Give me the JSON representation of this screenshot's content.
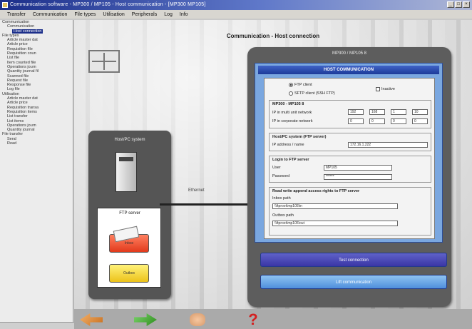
{
  "window": {
    "title": "Communication software - MP300 / MP105 - Host communication - [MP300 MP105]"
  },
  "menu": [
    "Transfer",
    "Communication",
    "File types",
    "Utilisation",
    "Peripherals",
    "Log",
    "Info"
  ],
  "tree": {
    "nodes": [
      {
        "label": "Communication",
        "depth": 0
      },
      {
        "label": "Communication",
        "depth": 1
      },
      {
        "label": "Host connection",
        "depth": 2,
        "selected": true
      },
      {
        "label": "File types",
        "depth": 0
      },
      {
        "label": "Article master dat",
        "depth": 1
      },
      {
        "label": "Article price",
        "depth": 1
      },
      {
        "label": "Requisition file",
        "depth": 1
      },
      {
        "label": "Requisition coun",
        "depth": 1
      },
      {
        "label": "List file",
        "depth": 1
      },
      {
        "label": "Item counted file",
        "depth": 1
      },
      {
        "label": "Operations journ",
        "depth": 1
      },
      {
        "label": "Quantity journal fil",
        "depth": 1
      },
      {
        "label": "Scanned file",
        "depth": 1
      },
      {
        "label": "Request file",
        "depth": 1
      },
      {
        "label": "Response file",
        "depth": 1
      },
      {
        "label": "Log file",
        "depth": 1
      },
      {
        "label": "Utilisation",
        "depth": 0
      },
      {
        "label": "Article master dat",
        "depth": 1
      },
      {
        "label": "Article price",
        "depth": 1
      },
      {
        "label": "Requisition transa",
        "depth": 1
      },
      {
        "label": "Requisition items",
        "depth": 1
      },
      {
        "label": "List transfer",
        "depth": 1
      },
      {
        "label": "List items",
        "depth": 1
      },
      {
        "label": "Operations journ",
        "depth": 1
      },
      {
        "label": "Quantity journal",
        "depth": 1
      },
      {
        "label": "File transfer",
        "depth": 0
      },
      {
        "label": "Send",
        "depth": 1
      },
      {
        "label": "Read",
        "depth": 1
      }
    ]
  },
  "main": {
    "title": "Communication - Host connection",
    "host_panel": {
      "title": "Host/PC system",
      "ftp_label": "FTP server",
      "folder_in": "Inbox",
      "folder_out": "Outbox"
    },
    "link_label": "Ethernet",
    "comm_panel": {
      "title": "MP300 / MP105 8",
      "header": "HOST COMMUNICATION",
      "opt_ftp": "FTP client",
      "opt_sftp": "SFTP client (SSH FTP)",
      "opt_inactive": "Inactive",
      "group_ip": {
        "label": "MP300 - MP105 8",
        "row1": "IP in multi unit network",
        "row2": "IP in corporate network",
        "ip1": [
          "192",
          "168",
          "1",
          "10"
        ],
        "ip2": [
          "0",
          "0",
          "0",
          "0"
        ]
      },
      "group_host": {
        "label": "Host/PC system (FTP server)",
        "row1": "IP address / name",
        "value": "172.16.1.222"
      },
      "group_login": {
        "label": "Login to FTP server",
        "user_label": "User",
        "user_value": "MP105",
        "pass_label": "Password",
        "pass_value": "******"
      },
      "group_paths": {
        "label": "Read write append access rights to FTP server",
        "in_label": "Inbox path",
        "in_value": "\\\\ftproot\\mp105\\in",
        "out_label": "Outbox path",
        "out_value": "\\\\ftproot\\mp105\\out"
      },
      "btn_test": "Test connection",
      "btn_launch": "Lift communication"
    }
  },
  "toolbar": {
    "back": "back-arrow-icon",
    "forward": "forward-arrow-icon",
    "hand": "hand-icon",
    "help": "help-icon"
  },
  "colors": {
    "title_bar": "#1c2f8a",
    "blue_panel": "#7aa7e0",
    "help": "#d32020"
  }
}
